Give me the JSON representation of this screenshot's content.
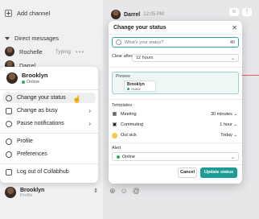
{
  "sidebar": {
    "add_channel": "Add channel",
    "direct_messages": "Direct messages",
    "dm_items": [
      {
        "name": "Rochelle",
        "status": "Typing"
      },
      {
        "name": "Darrel"
      }
    ]
  },
  "chat": {
    "header_name": "Darrel",
    "header_time": "12:05 PM"
  },
  "profile_menu": {
    "name": "Brooklyn",
    "status": "Online",
    "items": [
      {
        "label": "Change your status"
      },
      {
        "label": "Change as busy"
      },
      {
        "label": "Pause notifications"
      },
      {
        "label": "Profile"
      },
      {
        "label": "Preferences"
      },
      {
        "label": "Log out of Collabhub"
      }
    ]
  },
  "userbar": {
    "name": "Brooklyn",
    "sub": "Profile"
  },
  "modal": {
    "title": "Change your status",
    "input_placeholder": "What's your status?",
    "char_count": "40",
    "clear_after_label": "Clear after:",
    "clear_after_value": "12 hours",
    "preview_label": "Preview",
    "preview_name": "Brooklyn",
    "preview_status": "Online",
    "templates_label": "Templates",
    "templates": [
      {
        "icon": "calendar-icon",
        "label": "Meeting",
        "duration": "30 minutes"
      },
      {
        "icon": "bus-icon",
        "label": "Commuting",
        "duration": "1 hour"
      },
      {
        "icon": "sick-face-icon",
        "label": "Out sick",
        "duration": "Today"
      }
    ],
    "alert_label": "Alert",
    "alert_value": "Online",
    "cancel_label": "Cancel",
    "update_label": "Update status"
  },
  "colors": {
    "accent": "#1c9c93",
    "online": "#2fa866"
  }
}
